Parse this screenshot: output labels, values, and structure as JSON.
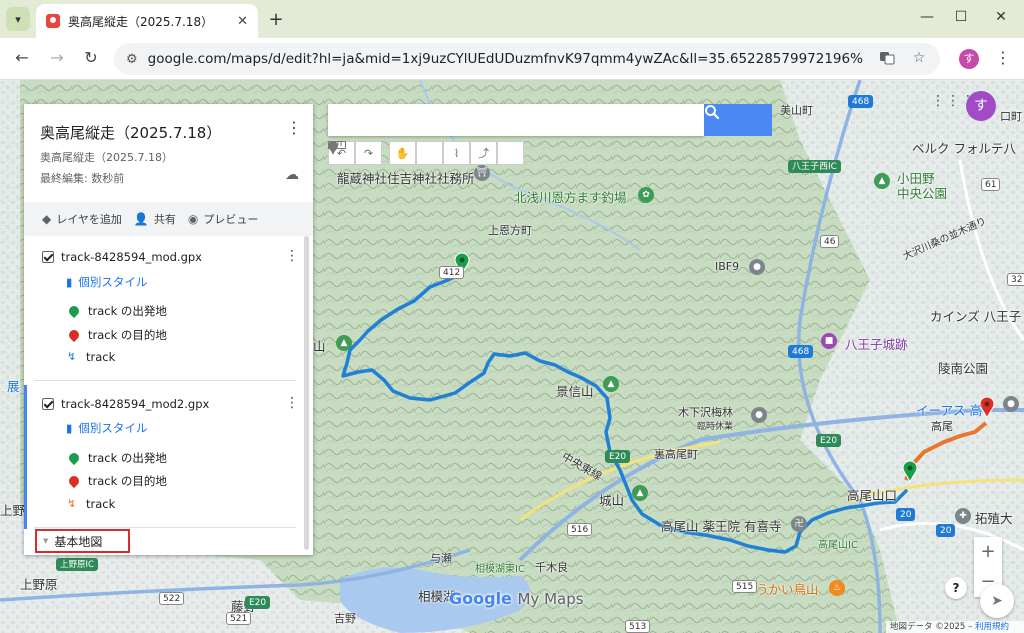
{
  "browser": {
    "tab_title": "奥高尾縦走（2025.7.18）",
    "url": "google.com/maps/d/edit?hl=ja&mid=1xj9uzCYlUEdUDuzmfnvK97qmm4ywZAc&ll=35.65228579972196%2C139.19795223...",
    "profile_initial": "す"
  },
  "panel": {
    "title": "奥高尾縦走（2025.7.18）",
    "subtitle": "奥高尾縦走（2025.7.18）",
    "last_edit": "最終編集: 数秒前",
    "actions": [
      "レイヤを追加",
      "共有",
      "プレビュー"
    ],
    "layers": [
      {
        "name": "track-8428594_mod.gpx",
        "style": "個別スタイル",
        "items": [
          "track の出発地",
          "track の目的地",
          "track"
        ]
      },
      {
        "name": "track-8428594_mod2.gpx",
        "style": "個別スタイル",
        "items": [
          "track の出発地",
          "track の目的地",
          "track"
        ]
      }
    ],
    "basemap": "基本地図"
  },
  "map": {
    "account_initial": "す",
    "labels": {
      "ryuzo": "龍蔵神社住吉神社社務所",
      "kitaasa": "北浅川恩方ます釣場",
      "kamionkata": "上恩方町",
      "ibf9": "IBF9",
      "kageshin": "景信山",
      "kinoshita": "木下沢梅林",
      "kinoshita_sub": "臨時休業",
      "urataka": "裏高尾町",
      "chuo": "中央東線",
      "shiroyama": "城山",
      "yakuoin": "高尾山 薬王院 有喜寺",
      "takaoguchi": "高尾山口",
      "takaoic": "高尾山IC",
      "ukai": "うかい鳥山",
      "yose": "与瀬",
      "sagamiko": "相模湖東IC",
      "sengira": "千木良",
      "sagamiko2": "相模湖",
      "fujino": "藤野",
      "yoshino": "吉野",
      "kaminohara": "上野原",
      "kaminohara_ic": "上野原IC",
      "kaminohara2": "上野",
      "miyama": "美山町",
      "hachioji_nishi": "八王子西IC",
      "oda": "小田野",
      "oda_park": "中央公園",
      "belc": "ベルク フォルテ八",
      "osawa": "大沢川桑の並木通り",
      "hachioji_castle": "八王子城跡",
      "cainz": "カインズ 八王子",
      "ryonan": "陵南公園",
      "aeon": "イーアス 高",
      "takuzen": "拓殖大",
      "exit": "口町",
      "ten": "展",
      "takao": "高尾",
      "yama": "山",
      "e20a": "E20",
      "e20b": "E20",
      "e20c": "E20",
      "r20a": "20",
      "r20b": "20",
      "r468": "468",
      "r468b": "468",
      "r516": "516",
      "r61": "61",
      "r46": "46",
      "r32": "32",
      "r515": "515",
      "r522": "522",
      "r521": "521",
      "r513": "513",
      "r412": "412"
    },
    "footer_data": "地図データ ©2025",
    "footer_link": "利用規約",
    "logo_google": "Google",
    "logo_mymaps": "My Maps",
    "zoom_in": "+",
    "zoom_out": "−",
    "help": "?"
  },
  "colors": {
    "track1": "#1f80d6",
    "track2": "#e8762c",
    "accent": "#4a89f3",
    "start_pin": "#1a9e4b",
    "end_pin": "#d93025"
  }
}
